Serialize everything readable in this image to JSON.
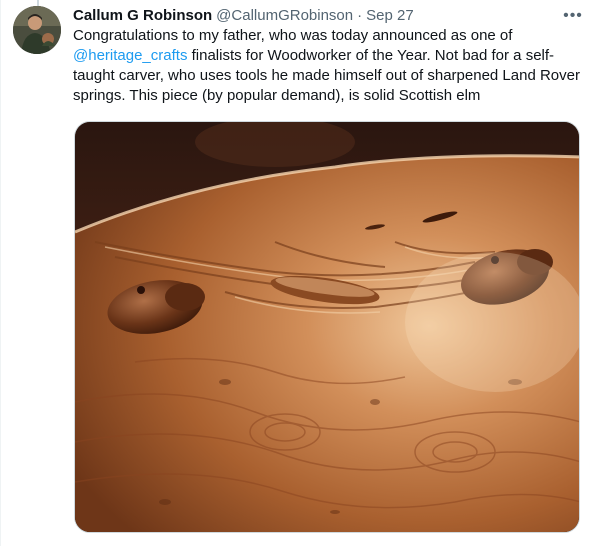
{
  "tweet": {
    "author": {
      "display_name": "Callum G Robinson",
      "handle": "@CallumGRobinson",
      "avatar_icon": "user-avatar"
    },
    "separator": "·",
    "timestamp": "Sep 27",
    "more_label": "•••",
    "text": {
      "part1": "Congratulations to my father, who was today announced as one of ",
      "mention": "@heritage_crafts",
      "part2": " finalists for Woodworker of the Year. Not bad for a self-taught carver, who uses tools he made himself out of sharpened Land Rover springs. This piece (by popular demand), is solid Scottish elm"
    },
    "media": {
      "subject": "carved elm table with two otter heads"
    },
    "colors": {
      "link": "#1d9bf0",
      "text": "#0f1419",
      "secondary": "#536471"
    }
  }
}
